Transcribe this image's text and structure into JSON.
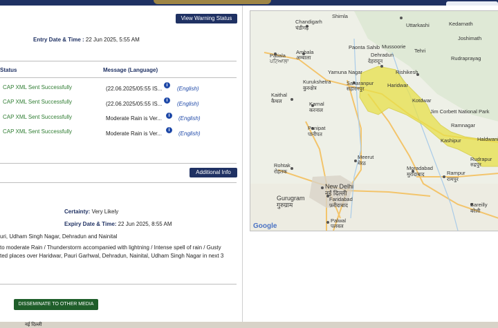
{
  "header": {
    "view_warning_button": "View Warning Status"
  },
  "entry": {
    "label": "Entry Date & Time :",
    "value": "22 Jun 2025, 5:55 AM"
  },
  "table": {
    "col_status": "Status",
    "col_message": "Message (Language)",
    "rows": [
      {
        "status": "CAP XML Sent Successfully",
        "message": "(22.06.2025/05:55 IS...",
        "lang": "(English)"
      },
      {
        "status": "CAP XML Sent Successfully",
        "message": "(22.06.2025/05:55 IS...",
        "lang": "(English)"
      },
      {
        "status": "CAP XML Sent Successfully",
        "message": "Moderate Rain is Ver...",
        "lang": "(English)"
      },
      {
        "status": "CAP XML Sent Successfully",
        "message": "Moderate Rain is Ver...",
        "lang": "(English)"
      }
    ]
  },
  "additional_info_button": "Additional Info",
  "certainty": {
    "label": "Certainty:",
    "value": "Very Likely"
  },
  "expiry": {
    "label": "Expiry Date & Time:",
    "value": "22 Jun 2025, 8:55 AM"
  },
  "area": "uri, Udham Singh Nagar, Dehradun and Nainital",
  "description_line1": "to moderate Rain / Thunderstorm accompanied with lightning / Intense spell of rain / Gusty",
  "description_line2": "ted places over Haridwar, Pauri Garhwal, Dehradun, Nainital, Udham Singh Nagar in next 3",
  "disseminate_button": "DISSEMINATE TO OTHER MEDIA",
  "map": {
    "labels": {
      "chandigarh": "Chandigarh",
      "chandigarh_hi": "चंडीगढ़",
      "shimla": "Shimla",
      "uttarkashi": "Uttarkashi",
      "kedarnath": "Kedarnath",
      "joshimath": "Joshimath",
      "mussoorie": "Mussoorie",
      "tehri": "Tehri",
      "dehradun": "Dehradun",
      "dehradun_hi": "देहरादून",
      "rishikesh": "Rishikesh",
      "rudraprayag": "Rudraprayag",
      "patiala": "Patiala",
      "patiala_hi": "ਪਟਿਆਲਾ",
      "ambala": "Ambala",
      "ambala_hi": "अम्बाला",
      "yamuna_nagar": "Yamuna Nagar",
      "paonta_sahib": "Paonta Sahib",
      "kurukshetra": "Kurukshetra",
      "kurukshetra_hi": "कुरुक्षेत्र",
      "saharanpur": "Saharanpur",
      "saharanpur_hi": "सहारनपुर",
      "haridwar": "Haridwar",
      "kaithal": "Kaithal",
      "kaithal_hi": "कैथल",
      "karnal": "Karnal",
      "karnal_hi": "करनाल",
      "kotdwar": "Kotdwar",
      "jim_corbett": "Jim Corbett National Park",
      "ramnagar": "Ramnagar",
      "kashipur": "Kashipur",
      "haldwani": "Haldwani",
      "rudrapur": "Rudrapur",
      "rudrapur_hi": "रुद्रपुर",
      "panipat": "Panipat",
      "panipat_hi": "पानीपत",
      "meerut": "Meerut",
      "meerut_hi": "मेरठ",
      "rohtak": "Rohtak",
      "rohtak_hi": "रोहतक",
      "moradabad": "Moradabad",
      "moradabad_hi": "मुरादाबाद",
      "rampur": "Rampur",
      "rampur_hi": "रामपुर",
      "new_delhi": "New Delhi",
      "new_delhi_hi": "नई दिल्ली",
      "gurugram": "Gurugram",
      "gurugram_hi": "गुरुग्राम",
      "faridabad": "Faridabad",
      "faridabad_hi": "फ़रीदाबाद",
      "bareilly": "Bareilly",
      "bareilly_hi": "बरेली",
      "palwal": "Palwal",
      "palwal_hi": "पलवल",
      "google": "Google"
    },
    "colors": {
      "warning_zone": "#e8e14a",
      "land": "#eef0e7",
      "highway": "#f3c46b",
      "water": "#a9cbe8"
    }
  },
  "bottom": {
    "text": "नई दिल्ली"
  }
}
